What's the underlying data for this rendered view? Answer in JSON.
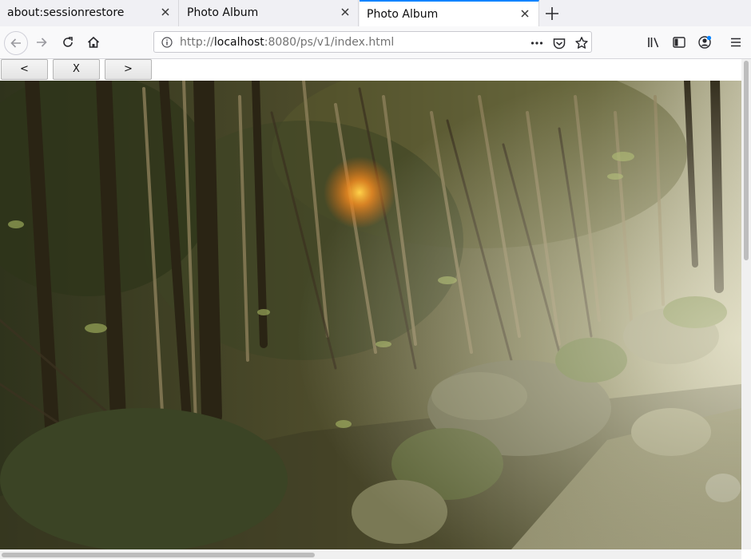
{
  "tabs": [
    {
      "title": "about:sessionrestore",
      "active": false
    },
    {
      "title": "Photo Album",
      "active": false
    },
    {
      "title": "Photo Album",
      "active": true
    }
  ],
  "address_bar": {
    "url_prefix": "http://",
    "url_host": "localhost",
    "url_rest": ":8080/ps/v1/index.html"
  },
  "album_controls": {
    "prev_label": "<",
    "close_label": "X",
    "next_label": ">"
  },
  "photo": {
    "subject": "forest path with trees and mossy rocks"
  },
  "colors": {
    "active_tab_accent": "#0a84ff",
    "chrome_background": "#f0f0f4"
  }
}
